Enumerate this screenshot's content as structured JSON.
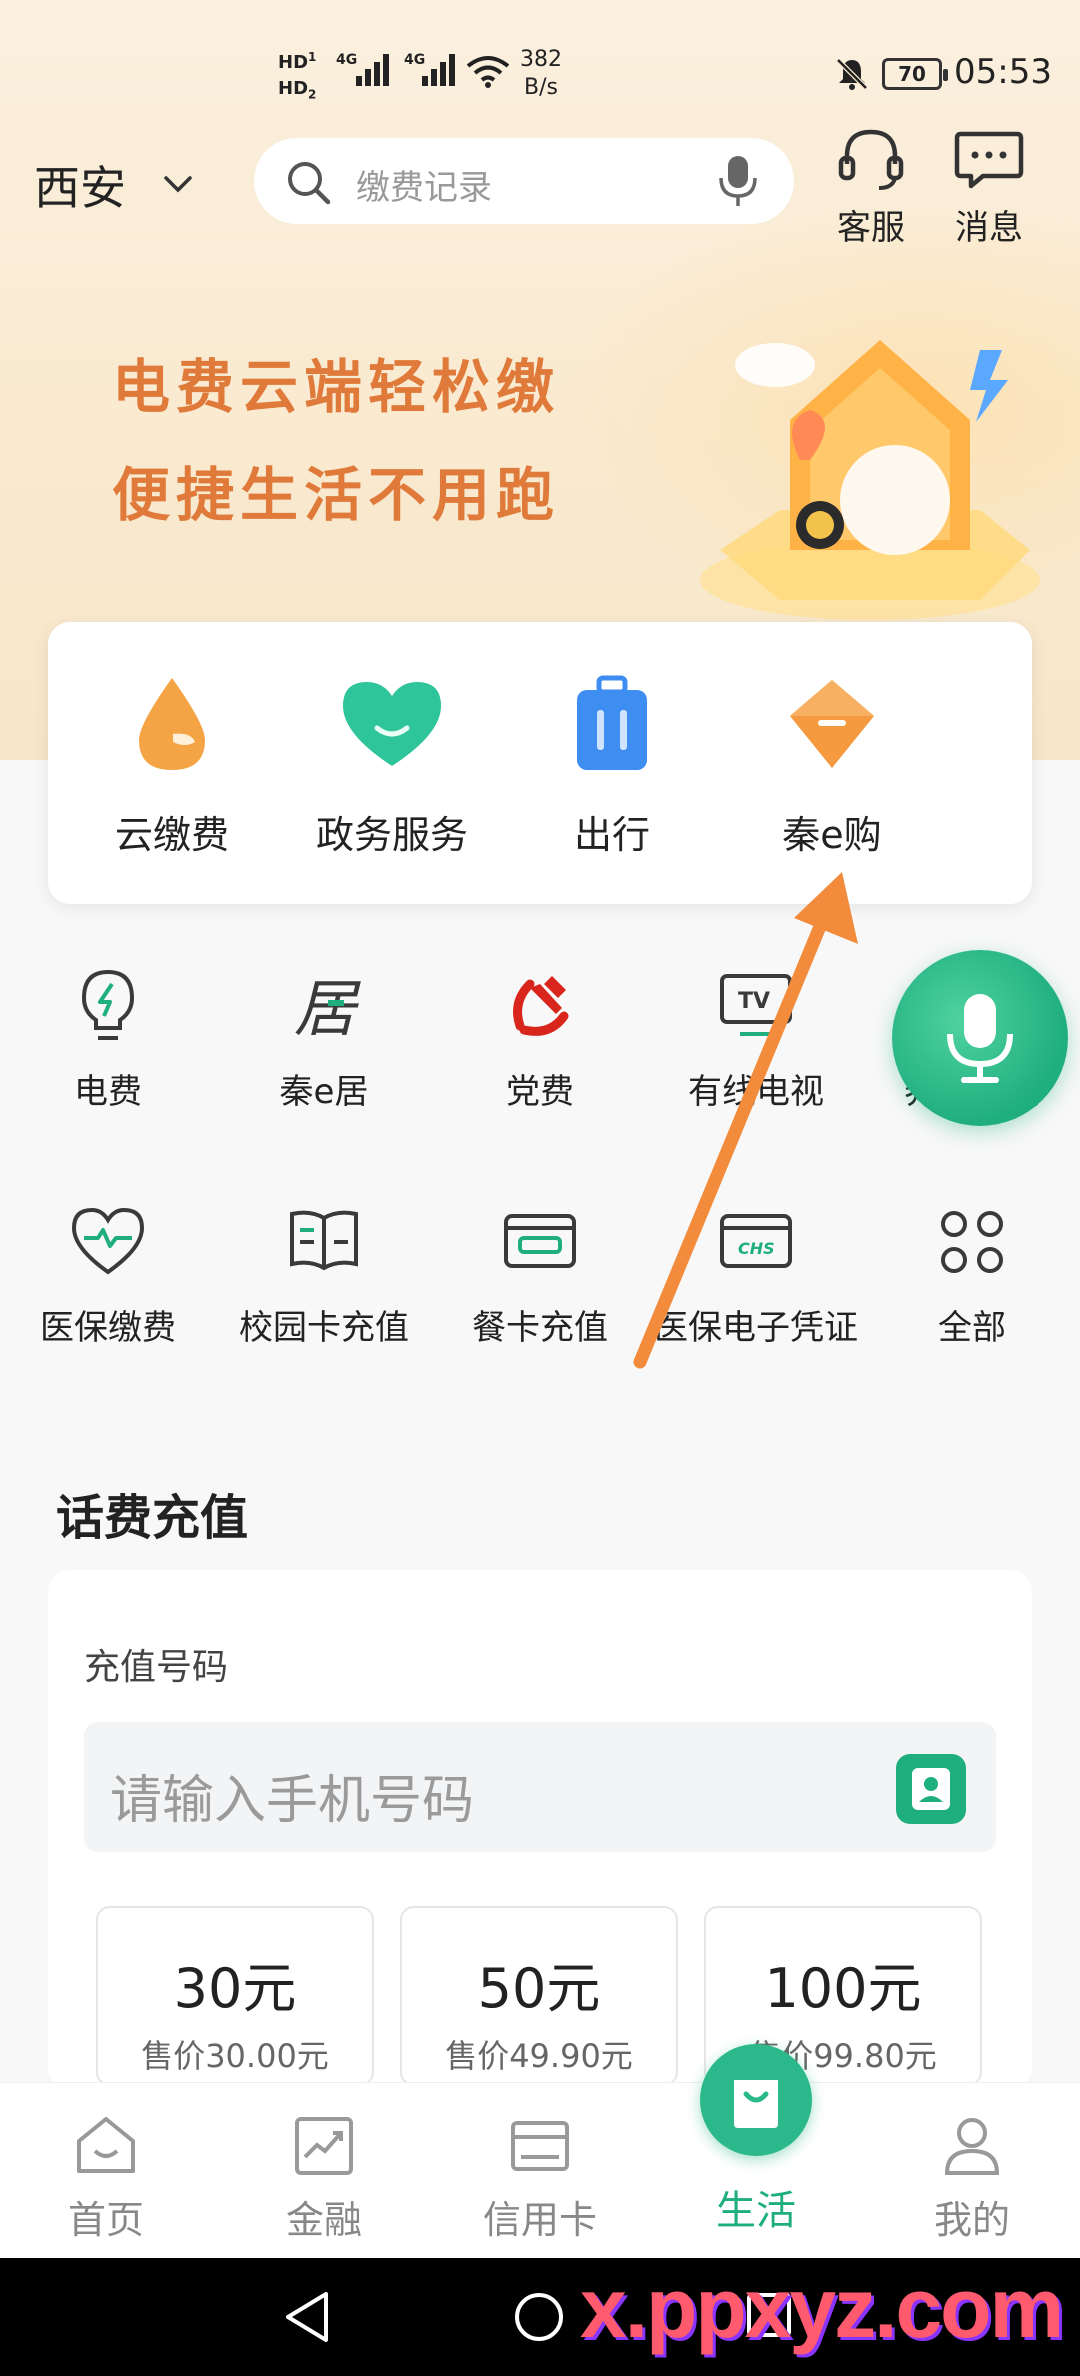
{
  "status_bar": {
    "hd1": "HD",
    "hd2": "HD",
    "net1": "4G",
    "net2": "4G",
    "speed_value": "382",
    "speed_unit": "B/s",
    "battery": "70",
    "time": "05:53"
  },
  "header": {
    "city": "西安",
    "search_placeholder": "缴费记录",
    "customer_service_label": "客服",
    "messages_label": "消息"
  },
  "banner": {
    "line1": "电费云端轻松缴",
    "line2": "便捷生活不用跑"
  },
  "quick_services": [
    {
      "label": "云缴费",
      "icon": "water-drop-icon",
      "color": "#f5a445"
    },
    {
      "label": "政务服务",
      "icon": "heart-icon",
      "color": "#2fc59a"
    },
    {
      "label": "出行",
      "icon": "luggage-icon",
      "color": "#3d8ef0"
    },
    {
      "label": "秦e购",
      "icon": "shopping-gem-icon",
      "color": "#f59a3e"
    }
  ],
  "services": [
    {
      "label": "电费",
      "icon": "lightbulb-icon"
    },
    {
      "label": "秦e居",
      "icon": "residence-icon"
    },
    {
      "label": "党费",
      "icon": "party-emblem-icon"
    },
    {
      "label": "有线电视",
      "icon": "tv-icon"
    },
    {
      "label": "养老保费",
      "icon": "pension-icon"
    },
    {
      "label": "医保缴费",
      "icon": "health-heart-icon"
    },
    {
      "label": "校园卡充值",
      "icon": "campus-card-icon"
    },
    {
      "label": "餐卡充值",
      "icon": "meal-card-icon"
    },
    {
      "label": "医保电子凭证",
      "icon": "chs-card-icon"
    },
    {
      "label": "全部",
      "icon": "all-grid-icon"
    }
  ],
  "recharge": {
    "section_title": "话费充值",
    "field_label": "充值号码",
    "phone_placeholder": "请输入手机号码",
    "amounts": [
      {
        "value": "30元",
        "price": "售价30.00元"
      },
      {
        "value": "50元",
        "price": "售价49.90元"
      },
      {
        "value": "100元",
        "price": "售价99.80元"
      }
    ]
  },
  "bottom_nav": [
    {
      "label": "首页",
      "icon": "home-icon"
    },
    {
      "label": "金融",
      "icon": "finance-chart-icon"
    },
    {
      "label": "信用卡",
      "icon": "credit-card-icon"
    },
    {
      "label": "生活",
      "icon": "shopping-bag-icon",
      "active": true
    },
    {
      "label": "我的",
      "icon": "profile-icon"
    }
  ],
  "watermark": "x.ppxyz.com",
  "colors": {
    "brand_green": "#1fae7e",
    "banner_orange": "#e07a3a",
    "arrow_orange": "#f28c3c"
  }
}
